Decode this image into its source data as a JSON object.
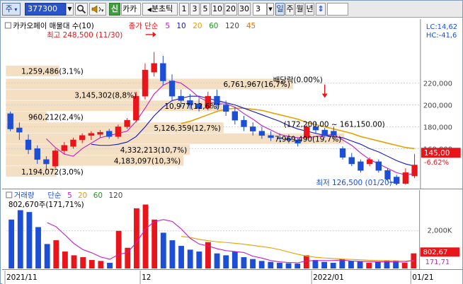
{
  "toolbar": {
    "market_label": "주",
    "code_value": "377300",
    "name_badge": "신",
    "name_text": "카카",
    "chart_type_label": "분초틱",
    "periods": [
      "1",
      "3",
      "5",
      "10",
      "20",
      "30"
    ],
    "count_value": "3",
    "period_units": [
      "일",
      "주",
      "월",
      "년"
    ],
    "updown_icon": "up-down-arrow-icon",
    "search_icon": "magnifier-icon",
    "sound_icon": "speaker-icon"
  },
  "colors": {
    "up": "#e8161b",
    "down": "#1d4fd6",
    "ma5": "#c41ac4",
    "ma10": "#1414c8",
    "ma20": "#e8a000",
    "ma60": "#1a9a1a",
    "ma120": "#444444",
    "ma45": "#e07000",
    "profile": "#f5dfc2"
  },
  "price_pane": {
    "title": "카카오페이 매물대 수(10)",
    "legend_prefix": "종가 단순",
    "legend_items": [
      {
        "label": "5",
        "color": "#c41ac4"
      },
      {
        "label": "10",
        "color": "#1414c8"
      },
      {
        "label": "20",
        "color": "#e8a000"
      },
      {
        "label": "60",
        "color": "#1a9a1a"
      },
      {
        "label": "120",
        "color": "#444444"
      },
      {
        "label": "45",
        "color": "#e07000"
      }
    ],
    "high_label": "최고 248,500 (11/30)",
    "low_label": "최저 126,500 (01/20)",
    "dividend_label": "배당락(0.00%)",
    "lc_label": "LC:14,62",
    "hc_label": "HC:-41,6",
    "current_price": "145,00",
    "current_change": "-6.62%",
    "range_label": "(172,200.00 ~ 161,150.00)",
    "y_ticks": [
      "220,000",
      "200,000",
      "180,000",
      "160,000"
    ],
    "profile": [
      {
        "label": "1,259,486(3,1%)",
        "price_low": 226000,
        "price_high": 236000,
        "volume": 1259486
      },
      {
        "label": "6,761,967(16,7%)",
        "price_low": 214000,
        "price_high": 224000,
        "volume": 6761967
      },
      {
        "label": "3,145,302(8,8%)",
        "price_low": 204000,
        "price_high": 214000,
        "volume": 3145302
      },
      {
        "label": "10,977(12,6%)",
        "price_low": 194000,
        "price_high": 204000,
        "volume": 5100000
      },
      {
        "label": "960,212(2,4%)",
        "price_low": 184000,
        "price_high": 194000,
        "volume": 960212
      },
      {
        "label": "5,126,359(12,7%)",
        "price_low": 174000,
        "price_high": 184000,
        "volume": 5126359
      },
      {
        "label": "7,969,490(19,7%)",
        "price_low": 164000,
        "price_high": 174000,
        "volume": 7969490
      },
      {
        "label": "4,332,213(10,7%)",
        "price_low": 154000,
        "price_high": 164000,
        "volume": 4332213
      },
      {
        "label": "4,183,097(10,3%)",
        "price_low": 144000,
        "price_high": 154000,
        "volume": 4183097
      },
      {
        "label": "1,194,072(3,0%)",
        "price_low": 134000,
        "price_high": 144000,
        "volume": 1194072
      }
    ]
  },
  "volume_pane": {
    "title": "거래량",
    "legend_prefix": "단순",
    "legend_items": [
      {
        "label": "5",
        "color": "#c41ac4"
      },
      {
        "label": "20",
        "color": "#e8a000"
      },
      {
        "label": "60",
        "color": "#1a9a1a"
      },
      {
        "label": "120",
        "color": "#444444"
      }
    ],
    "first_value_label": "802,670주(171,71%)",
    "y_tick": "2,000K",
    "current_volume": "802,67",
    "current_ratio": "171,71"
  },
  "x_axis": {
    "labels": [
      {
        "text": "2021/11",
        "index": 0
      },
      {
        "text": "12",
        "index": 15
      },
      {
        "text": "2022/01",
        "index": 34
      },
      {
        "text": "01/21",
        "index": 45
      }
    ]
  },
  "chart_data": {
    "type": "candlestick",
    "ylim": [
      124000,
      258000
    ],
    "volume_ylim": [
      0,
      3500000
    ],
    "candles": [
      {
        "o": 192000,
        "h": 194000,
        "c": 178000,
        "l": 176000,
        "v": 2600000
      },
      {
        "o": 179000,
        "h": 184000,
        "c": 175000,
        "l": 168000,
        "v": 3100000
      },
      {
        "o": 168000,
        "h": 173000,
        "c": 159000,
        "l": 155000,
        "v": 3000000
      },
      {
        "o": 160000,
        "h": 163000,
        "c": 150000,
        "l": 146000,
        "v": 2200000
      },
      {
        "o": 150000,
        "h": 153000,
        "c": 146000,
        "l": 140000,
        "v": 1300000
      },
      {
        "o": 144000,
        "h": 160000,
        "c": 158000,
        "l": 142000,
        "v": 1500000
      },
      {
        "o": 158000,
        "h": 166000,
        "c": 163000,
        "l": 155000,
        "v": 900000
      },
      {
        "o": 162000,
        "h": 170000,
        "c": 168000,
        "l": 160000,
        "v": 700000
      },
      {
        "o": 168000,
        "h": 174000,
        "c": 172000,
        "l": 165000,
        "v": 600000
      },
      {
        "o": 172000,
        "h": 176000,
        "c": 174000,
        "l": 168000,
        "v": 450000
      },
      {
        "o": 173000,
        "h": 177000,
        "c": 175000,
        "l": 170000,
        "v": 400000
      },
      {
        "o": 176000,
        "h": 178000,
        "c": 171000,
        "l": 169000,
        "v": 300000
      },
      {
        "o": 171000,
        "h": 182000,
        "c": 180000,
        "l": 169000,
        "v": 2000000
      },
      {
        "o": 180000,
        "h": 188000,
        "c": 186000,
        "l": 178000,
        "v": 1100000
      },
      {
        "o": 186000,
        "h": 212000,
        "c": 208000,
        "l": 184000,
        "v": 3200000
      },
      {
        "o": 208000,
        "h": 238000,
        "c": 232000,
        "l": 205000,
        "v": 3400000
      },
      {
        "o": 230000,
        "h": 248500,
        "c": 238000,
        "l": 226000,
        "v": 2600000
      },
      {
        "o": 238000,
        "h": 245000,
        "c": 222000,
        "l": 218000,
        "v": 1900000
      },
      {
        "o": 222000,
        "h": 228000,
        "c": 208000,
        "l": 204000,
        "v": 1500000
      },
      {
        "o": 208000,
        "h": 214000,
        "c": 204000,
        "l": 198000,
        "v": 1200000
      },
      {
        "o": 204000,
        "h": 210000,
        "c": 200000,
        "l": 196000,
        "v": 1000000
      },
      {
        "o": 201000,
        "h": 206000,
        "c": 197000,
        "l": 194000,
        "v": 900000
      },
      {
        "o": 197000,
        "h": 212000,
        "c": 208000,
        "l": 195000,
        "v": 1400000
      },
      {
        "o": 208000,
        "h": 214000,
        "c": 200000,
        "l": 196000,
        "v": 800000
      },
      {
        "o": 200000,
        "h": 204000,
        "c": 194000,
        "l": 190000,
        "v": 700000
      },
      {
        "o": 194000,
        "h": 198000,
        "c": 186000,
        "l": 182000,
        "v": 900000
      },
      {
        "o": 186000,
        "h": 190000,
        "c": 180000,
        "l": 176000,
        "v": 600000
      },
      {
        "o": 180000,
        "h": 184000,
        "c": 176000,
        "l": 172000,
        "v": 500000
      },
      {
        "o": 176000,
        "h": 180000,
        "c": 172000,
        "l": 169000,
        "v": 400000
      },
      {
        "o": 172000,
        "h": 176000,
        "c": 170000,
        "l": 167000,
        "v": 350000
      },
      {
        "o": 170000,
        "h": 174000,
        "c": 169000,
        "l": 166000,
        "v": 300000
      },
      {
        "o": 169000,
        "h": 173000,
        "c": 168000,
        "l": 165000,
        "v": 280000
      },
      {
        "o": 168000,
        "h": 170000,
        "c": 165000,
        "l": 162000,
        "v": 260000
      },
      {
        "o": 170000,
        "h": 182000,
        "c": 180000,
        "l": 168000,
        "v": 700000
      },
      {
        "o": 180000,
        "h": 184000,
        "c": 177000,
        "l": 174000,
        "v": 450000
      },
      {
        "o": 177000,
        "h": 179000,
        "c": 172000,
        "l": 170000,
        "v": 350000
      },
      {
        "o": 176000,
        "h": 180000,
        "c": 172000,
        "l": 168000,
        "v": 300000
      },
      {
        "o": 160000,
        "h": 162000,
        "c": 152000,
        "l": 150000,
        "v": 500000
      },
      {
        "o": 152000,
        "h": 156000,
        "c": 146000,
        "l": 144000,
        "v": 400000
      },
      {
        "o": 148000,
        "h": 150000,
        "c": 140000,
        "l": 138000,
        "v": 380000
      },
      {
        "o": 146000,
        "h": 152000,
        "c": 150000,
        "l": 144000,
        "v": 300000
      },
      {
        "o": 148000,
        "h": 150000,
        "c": 140000,
        "l": 138000,
        "v": 350000
      },
      {
        "o": 140000,
        "h": 142000,
        "c": 132000,
        "l": 130000,
        "v": 400000
      },
      {
        "o": 134000,
        "h": 136000,
        "c": 128000,
        "l": 126500,
        "v": 420000
      },
      {
        "o": 128000,
        "h": 142000,
        "c": 138000,
        "l": 127000,
        "v": 300000
      },
      {
        "o": 135000,
        "h": 155000,
        "c": 145000,
        "l": 133000,
        "v": 802670
      }
    ],
    "ma5": [
      null,
      null,
      null,
      null,
      169000,
      161000,
      155000,
      153000,
      160000,
      165000,
      170000,
      172000,
      174000,
      176000,
      185000,
      197000,
      210000,
      218000,
      222000,
      220000,
      214000,
      207000,
      203000,
      201000,
      201000,
      198000,
      192000,
      187000,
      181000,
      177000,
      173000,
      171000,
      170000,
      170000,
      171000,
      172000,
      173000,
      168000,
      163000,
      156000,
      150000,
      146000,
      142000,
      138000,
      136000,
      137000
    ],
    "ma10": [
      null,
      null,
      null,
      null,
      null,
      null,
      null,
      null,
      null,
      164000,
      163000,
      163000,
      164000,
      166000,
      171000,
      180000,
      190000,
      198000,
      204000,
      206000,
      208000,
      208000,
      206000,
      204000,
      202000,
      200000,
      197000,
      194000,
      191000,
      188000,
      185000,
      181000,
      178000,
      176000,
      174000,
      172000,
      171000,
      170000,
      167000,
      164000,
      160000,
      157000,
      153000,
      149000,
      146000,
      144000
    ],
    "ma20": [
      null,
      null,
      null,
      null,
      null,
      null,
      null,
      null,
      null,
      null,
      null,
      null,
      null,
      null,
      null,
      null,
      null,
      null,
      null,
      183000,
      185000,
      188000,
      191000,
      194000,
      196000,
      197000,
      197000,
      196000,
      195000,
      193000,
      191000,
      189000,
      187000,
      184000,
      182000,
      180000,
      178000,
      176000,
      174000,
      171000,
      169000,
      167000,
      165000,
      163000,
      161000,
      160000
    ],
    "vol_ma5": [
      null,
      null,
      null,
      null,
      2440000,
      2220000,
      1780000,
      1320000,
      1000000,
      830000,
      610000,
      490000,
      750000,
      850000,
      1400000,
      2100000,
      2500000,
      2600000,
      2500000,
      2100000,
      1600000,
      1300000,
      1200000,
      1050000,
      950000,
      900000,
      850000,
      650000,
      550000,
      420000,
      350000,
      320000,
      300000,
      400000,
      420000,
      420000,
      420000,
      450000,
      400000,
      380000,
      370000,
      360000,
      360000,
      350000,
      340000,
      450000
    ],
    "vol_ma20": [
      null,
      null,
      null,
      null,
      null,
      null,
      null,
      null,
      null,
      null,
      null,
      null,
      null,
      null,
      null,
      null,
      null,
      null,
      null,
      1700000,
      1650000,
      1550000,
      1480000,
      1420000,
      1380000,
      1340000,
      1290000,
      1230000,
      1160000,
      1100000,
      1000000,
      880000,
      760000,
      660000,
      600000,
      560000,
      530000,
      500000,
      480000,
      460000,
      440000,
      430000,
      420000,
      410000,
      400000,
      420000
    ]
  }
}
